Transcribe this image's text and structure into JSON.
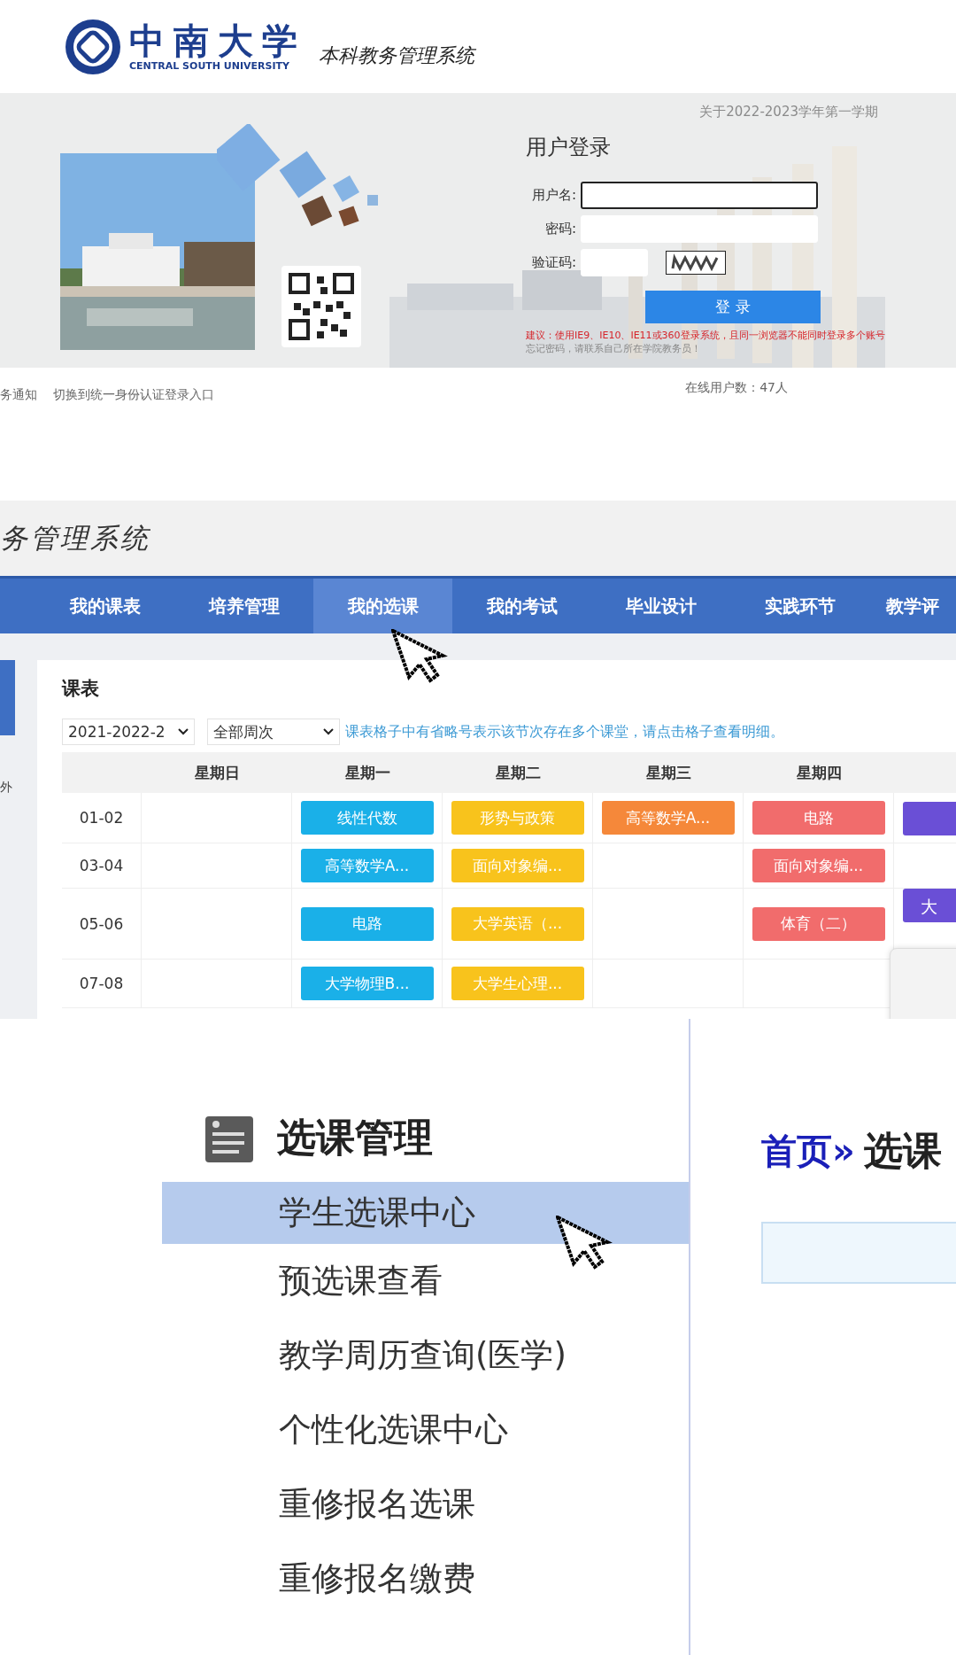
{
  "login_page": {
    "logo": {
      "name_cn": "中南大学",
      "name_en": "CENTRAL SOUTH UNIVERSITY",
      "system": "本科教务管理系统"
    },
    "notice": "关于2022-2023学年第一学期",
    "login_form": {
      "title": "用户登录",
      "fields": [
        {
          "label": "用户名:",
          "kind": "text",
          "focused": true
        },
        {
          "label": "密码:",
          "kind": "text",
          "focused": false
        },
        {
          "label": "验证码:",
          "kind": "captcha",
          "focused": false
        }
      ],
      "button": "登 录",
      "warning": "建议：使用IE9、IE10、IE11或360登录系统，且同一浏览器不能同时登录多个账号",
      "hint": "忘记密码，请联系自己所在学院教务员！"
    },
    "links": [
      "务通知",
      "切换到统一身份认证登录入口"
    ],
    "online": "在线用户数：47人"
  },
  "timetable_page": {
    "title": "务管理系统",
    "nav": [
      {
        "label": "我的课表",
        "selected": false
      },
      {
        "label": "培养管理",
        "selected": false
      },
      {
        "label": "我的选课",
        "selected": true
      },
      {
        "label": "我的考试",
        "selected": false
      },
      {
        "label": "毕业设计",
        "selected": false
      },
      {
        "label": "实践环节",
        "selected": false
      },
      {
        "label": "教学评",
        "selected": false
      }
    ],
    "side_text": "外",
    "card_title": "课表",
    "term": "2021-2022-2",
    "weeks": "全部周次",
    "tip": "课表格子中有省略号表示该节次存在多个课堂，请点击格子查看明细。",
    "columns": [
      "星期日",
      "星期一",
      "星期二",
      "星期三",
      "星期四"
    ],
    "rows": [
      {
        "time": "01-02",
        "cells": [
          {},
          {
            "text": "线性代数",
            "color": "#1ab0e8"
          },
          {
            "text": "形势与政策",
            "color": "#f8c31c"
          },
          {
            "text": "高等数学A...",
            "color": "#f5883a"
          },
          {
            "text": "电路",
            "color": "#f16c6c"
          },
          {
            "color": "#6a4fd6"
          }
        ]
      },
      {
        "time": "03-04",
        "cells": [
          {},
          {
            "text": "高等数学A...",
            "color": "#1ab0e8"
          },
          {
            "text": "面向对象编...",
            "color": "#f8c31c"
          },
          {},
          {
            "text": "面向对象编...",
            "color": "#f16c6c"
          },
          {}
        ]
      },
      {
        "time": "05-06",
        "cells": [
          {},
          {
            "text": "电路",
            "color": "#1ab0e8"
          },
          {
            "text": "大学英语（...",
            "color": "#f8c31c"
          },
          {},
          {
            "text": "体育（二）",
            "color": "#f16c6c"
          },
          {
            "text": "大",
            "color": "#6a4fd6"
          }
        ]
      },
      {
        "time": "07-08",
        "cells": [
          {},
          {
            "text": "大学物理B...",
            "color": "#1ab0e8"
          },
          {
            "text": "大学生心理...",
            "color": "#f8c31c"
          },
          {},
          {},
          {}
        ]
      }
    ]
  },
  "course_page": {
    "section_title": "选课管理",
    "items": [
      {
        "label": "学生选课中心",
        "selected": true
      },
      {
        "label": "预选课查看",
        "selected": false
      },
      {
        "label": "教学周历查询(医学)",
        "selected": false
      },
      {
        "label": "个性化选课中心",
        "selected": false
      },
      {
        "label": "重修报名选课",
        "selected": false
      },
      {
        "label": "重修报名缴费",
        "selected": false
      }
    ],
    "breadcrumb_home": "首页»",
    "breadcrumb_current": "选课"
  }
}
